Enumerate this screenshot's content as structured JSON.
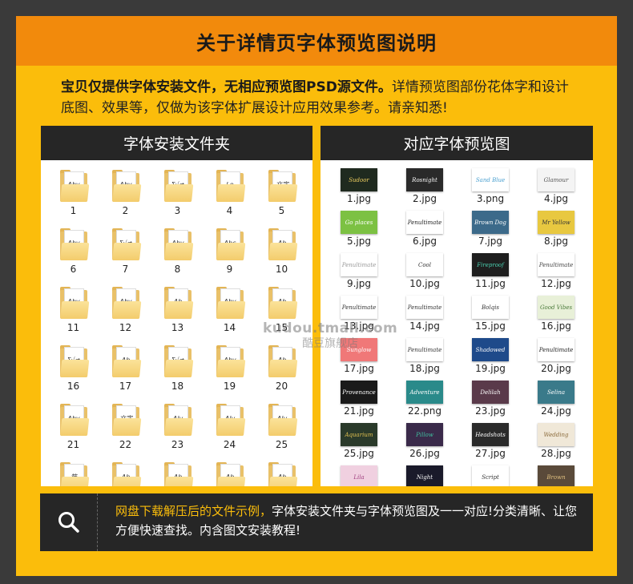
{
  "header": {
    "title": "关于详情页字体预览图说明"
  },
  "intro": {
    "bold": "宝贝仅提供字体安装文件，无相应预览图PSD源文件。",
    "normal": "详情预览图部份花体字和设计底图、效果等，仅做为该字体扩展设计应用效果参考。请亲知悉!"
  },
  "left_panel": {
    "title": "字体安装文件夹",
    "folders": [
      {
        "label": "1",
        "glyph": "Aby"
      },
      {
        "label": "2",
        "glyph": "Aby"
      },
      {
        "label": "3",
        "glyph": "Σ√≠"
      },
      {
        "label": "4",
        "glyph": "Lo"
      },
      {
        "label": "5",
        "glyph": "文字"
      },
      {
        "label": "6",
        "glyph": "Aby"
      },
      {
        "label": "7",
        "glyph": "Σ√≠"
      },
      {
        "label": "8",
        "glyph": "Aby"
      },
      {
        "label": "9",
        "glyph": "Abc"
      },
      {
        "label": "10",
        "glyph": "Ab"
      },
      {
        "label": "11",
        "glyph": "Aby"
      },
      {
        "label": "12",
        "glyph": "Aby"
      },
      {
        "label": "13",
        "glyph": "Ab"
      },
      {
        "label": "14",
        "glyph": "Aby"
      },
      {
        "label": "15",
        "glyph": "Ab"
      },
      {
        "label": "16",
        "glyph": "Σ√≠"
      },
      {
        "label": "17",
        "glyph": "Ab"
      },
      {
        "label": "18",
        "glyph": "Σ√≠"
      },
      {
        "label": "19",
        "glyph": "Aby"
      },
      {
        "label": "20",
        "glyph": "Ab"
      },
      {
        "label": "21",
        "glyph": "Aby"
      },
      {
        "label": "22",
        "glyph": "文字"
      },
      {
        "label": "23",
        "glyph": "Aly"
      },
      {
        "label": "24",
        "glyph": "Aly"
      },
      {
        "label": "25",
        "glyph": "Aly"
      },
      {
        "label": "",
        "glyph": "筋"
      },
      {
        "label": "",
        "glyph": "Ab"
      },
      {
        "label": "",
        "glyph": "Ab"
      },
      {
        "label": "",
        "glyph": "Ab"
      },
      {
        "label": "",
        "glyph": "Ab"
      }
    ]
  },
  "right_panel": {
    "title": "对应字体预览图",
    "thumbs": [
      {
        "label": "1.jpg",
        "bg": "#1f2a1f",
        "fg": "#f0d060",
        "glyph": "Sudoor"
      },
      {
        "label": "2.jpg",
        "bg": "#2a2a2a",
        "fg": "#ffffff",
        "glyph": "Rosnight"
      },
      {
        "label": "3.png",
        "bg": "#ffffff",
        "fg": "#4aa0d0",
        "glyph": "Sand Blue"
      },
      {
        "label": "4.jpg",
        "bg": "#f4f4f4",
        "fg": "#555555",
        "glyph": "Glamour"
      },
      {
        "label": "5.jpg",
        "bg": "#7cc143",
        "fg": "#ffffff",
        "glyph": "Go places"
      },
      {
        "label": "6.jpg",
        "bg": "#ffffff",
        "fg": "#222222",
        "glyph": "Penultimate"
      },
      {
        "label": "7.jpg",
        "bg": "#3c6a8a",
        "fg": "#ffffff",
        "glyph": "Brown Dog"
      },
      {
        "label": "8.jpg",
        "bg": "#e8c840",
        "fg": "#333333",
        "glyph": "Mr Yellow"
      },
      {
        "label": "9.jpg",
        "bg": "#ffffff",
        "fg": "#999999",
        "glyph": "Penultimate"
      },
      {
        "label": "10.jpg",
        "bg": "#ffffff",
        "fg": "#333333",
        "glyph": "Cool"
      },
      {
        "label": "11.jpg",
        "bg": "#1e1e1e",
        "fg": "#4ad0b0",
        "glyph": "Fireproof"
      },
      {
        "label": "12.jpg",
        "bg": "#ffffff",
        "fg": "#444444",
        "glyph": "Penultimate"
      },
      {
        "label": "13.jpg",
        "bg": "#ffffff",
        "fg": "#333333",
        "glyph": "Penultimate"
      },
      {
        "label": "14.jpg",
        "bg": "#ffffff",
        "fg": "#333333",
        "glyph": "Penultimate"
      },
      {
        "label": "15.jpg",
        "bg": "#ffffff",
        "fg": "#333333",
        "glyph": "Bolqis"
      },
      {
        "label": "16.jpg",
        "bg": "#e8f0d8",
        "fg": "#4a7a3a",
        "glyph": "Good Vibes"
      },
      {
        "label": "17.jpg",
        "bg": "#f07878",
        "fg": "#ffffff",
        "glyph": "Sunglow"
      },
      {
        "label": "18.jpg",
        "bg": "#ffffff",
        "fg": "#333333",
        "glyph": "Penultimate"
      },
      {
        "label": "19.jpg",
        "bg": "#1e4a8a",
        "fg": "#ffffff",
        "glyph": "Shadowed"
      },
      {
        "label": "20.jpg",
        "bg": "#ffffff",
        "fg": "#222222",
        "glyph": "Penultimate"
      },
      {
        "label": "21.jpg",
        "bg": "#1a1a1a",
        "fg": "#ffffff",
        "glyph": "Provenance"
      },
      {
        "label": "22.png",
        "bg": "#2a8a8a",
        "fg": "#ffffff",
        "glyph": "Adventure"
      },
      {
        "label": "23.jpg",
        "bg": "#5a3a4a",
        "fg": "#ffffff",
        "glyph": "Delilah"
      },
      {
        "label": "24.jpg",
        "bg": "#3a7a8a",
        "fg": "#ffffff",
        "glyph": "Selina"
      },
      {
        "label": "25.jpg",
        "bg": "#2a3a2a",
        "fg": "#e0c050",
        "glyph": "Aquarium"
      },
      {
        "label": "26.jpg",
        "bg": "#3a2a4a",
        "fg": "#40c0a0",
        "glyph": "Pillow"
      },
      {
        "label": "27.jpg",
        "bg": "#2a2a2a",
        "fg": "#ffffff",
        "glyph": "Headshots"
      },
      {
        "label": "28.jpg",
        "bg": "#f0e8d8",
        "fg": "#8a6a3a",
        "glyph": "Wedding"
      },
      {
        "label": "",
        "bg": "#f0d0e0",
        "fg": "#a04080",
        "glyph": "Lila"
      },
      {
        "label": "",
        "bg": "#1a1a2a",
        "fg": "#ffffff",
        "glyph": "Night"
      },
      {
        "label": "",
        "bg": "#ffffff",
        "fg": "#333333",
        "glyph": "Script"
      },
      {
        "label": "",
        "bg": "#5a4a3a",
        "fg": "#e0c080",
        "glyph": "Brown"
      }
    ]
  },
  "watermark": {
    "line1": "kudou.tmall.com",
    "line2": "酷豆旗舰店"
  },
  "bottom": {
    "highlight": "网盘下载解压后的文件示例，",
    "rest": "字体安装文件夹与字体预览图及一一对应!分类清晰、让您方便快速查找。内含图文安装教程!"
  },
  "colors": {
    "frame": "#fbbd0b",
    "header": "#f28a0c",
    "dark": "#262626"
  }
}
